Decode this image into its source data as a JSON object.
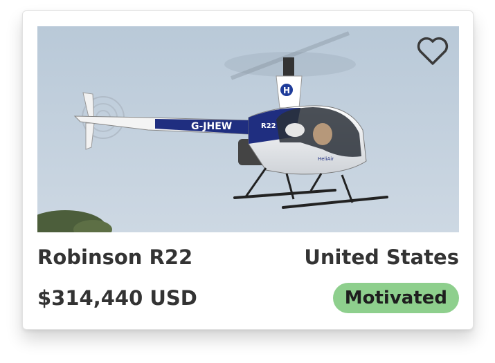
{
  "listing": {
    "title": "Robinson R22",
    "location": "United States",
    "price": "$314,440 USD",
    "status_badge": "Motivated",
    "badge_color": "#8ecf8d",
    "favorite_icon": "heart-outline-icon",
    "photo": {
      "subject": "helicopter",
      "registration": "G-JHEW",
      "model_badge": "R22",
      "tail_logo": "H",
      "door_text": "HeliAir"
    }
  }
}
